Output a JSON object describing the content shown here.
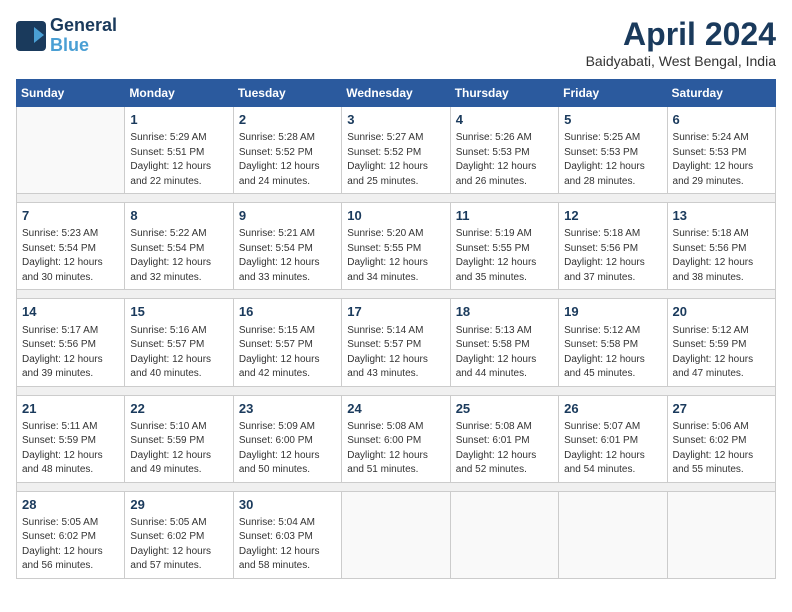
{
  "logo": {
    "line1": "General",
    "line2": "Blue"
  },
  "title": "April 2024",
  "subtitle": "Baidyabati, West Bengal, India",
  "weekdays": [
    "Sunday",
    "Monday",
    "Tuesday",
    "Wednesday",
    "Thursday",
    "Friday",
    "Saturday"
  ],
  "weeks": [
    [
      {
        "day": "",
        "info": ""
      },
      {
        "day": "1",
        "info": "Sunrise: 5:29 AM\nSunset: 5:51 PM\nDaylight: 12 hours\nand 22 minutes."
      },
      {
        "day": "2",
        "info": "Sunrise: 5:28 AM\nSunset: 5:52 PM\nDaylight: 12 hours\nand 24 minutes."
      },
      {
        "day": "3",
        "info": "Sunrise: 5:27 AM\nSunset: 5:52 PM\nDaylight: 12 hours\nand 25 minutes."
      },
      {
        "day": "4",
        "info": "Sunrise: 5:26 AM\nSunset: 5:53 PM\nDaylight: 12 hours\nand 26 minutes."
      },
      {
        "day": "5",
        "info": "Sunrise: 5:25 AM\nSunset: 5:53 PM\nDaylight: 12 hours\nand 28 minutes."
      },
      {
        "day": "6",
        "info": "Sunrise: 5:24 AM\nSunset: 5:53 PM\nDaylight: 12 hours\nand 29 minutes."
      }
    ],
    [
      {
        "day": "7",
        "info": "Sunrise: 5:23 AM\nSunset: 5:54 PM\nDaylight: 12 hours\nand 30 minutes."
      },
      {
        "day": "8",
        "info": "Sunrise: 5:22 AM\nSunset: 5:54 PM\nDaylight: 12 hours\nand 32 minutes."
      },
      {
        "day": "9",
        "info": "Sunrise: 5:21 AM\nSunset: 5:54 PM\nDaylight: 12 hours\nand 33 minutes."
      },
      {
        "day": "10",
        "info": "Sunrise: 5:20 AM\nSunset: 5:55 PM\nDaylight: 12 hours\nand 34 minutes."
      },
      {
        "day": "11",
        "info": "Sunrise: 5:19 AM\nSunset: 5:55 PM\nDaylight: 12 hours\nand 35 minutes."
      },
      {
        "day": "12",
        "info": "Sunrise: 5:18 AM\nSunset: 5:56 PM\nDaylight: 12 hours\nand 37 minutes."
      },
      {
        "day": "13",
        "info": "Sunrise: 5:18 AM\nSunset: 5:56 PM\nDaylight: 12 hours\nand 38 minutes."
      }
    ],
    [
      {
        "day": "14",
        "info": "Sunrise: 5:17 AM\nSunset: 5:56 PM\nDaylight: 12 hours\nand 39 minutes."
      },
      {
        "day": "15",
        "info": "Sunrise: 5:16 AM\nSunset: 5:57 PM\nDaylight: 12 hours\nand 40 minutes."
      },
      {
        "day": "16",
        "info": "Sunrise: 5:15 AM\nSunset: 5:57 PM\nDaylight: 12 hours\nand 42 minutes."
      },
      {
        "day": "17",
        "info": "Sunrise: 5:14 AM\nSunset: 5:57 PM\nDaylight: 12 hours\nand 43 minutes."
      },
      {
        "day": "18",
        "info": "Sunrise: 5:13 AM\nSunset: 5:58 PM\nDaylight: 12 hours\nand 44 minutes."
      },
      {
        "day": "19",
        "info": "Sunrise: 5:12 AM\nSunset: 5:58 PM\nDaylight: 12 hours\nand 45 minutes."
      },
      {
        "day": "20",
        "info": "Sunrise: 5:12 AM\nSunset: 5:59 PM\nDaylight: 12 hours\nand 47 minutes."
      }
    ],
    [
      {
        "day": "21",
        "info": "Sunrise: 5:11 AM\nSunset: 5:59 PM\nDaylight: 12 hours\nand 48 minutes."
      },
      {
        "day": "22",
        "info": "Sunrise: 5:10 AM\nSunset: 5:59 PM\nDaylight: 12 hours\nand 49 minutes."
      },
      {
        "day": "23",
        "info": "Sunrise: 5:09 AM\nSunset: 6:00 PM\nDaylight: 12 hours\nand 50 minutes."
      },
      {
        "day": "24",
        "info": "Sunrise: 5:08 AM\nSunset: 6:00 PM\nDaylight: 12 hours\nand 51 minutes."
      },
      {
        "day": "25",
        "info": "Sunrise: 5:08 AM\nSunset: 6:01 PM\nDaylight: 12 hours\nand 52 minutes."
      },
      {
        "day": "26",
        "info": "Sunrise: 5:07 AM\nSunset: 6:01 PM\nDaylight: 12 hours\nand 54 minutes."
      },
      {
        "day": "27",
        "info": "Sunrise: 5:06 AM\nSunset: 6:02 PM\nDaylight: 12 hours\nand 55 minutes."
      }
    ],
    [
      {
        "day": "28",
        "info": "Sunrise: 5:05 AM\nSunset: 6:02 PM\nDaylight: 12 hours\nand 56 minutes."
      },
      {
        "day": "29",
        "info": "Sunrise: 5:05 AM\nSunset: 6:02 PM\nDaylight: 12 hours\nand 57 minutes."
      },
      {
        "day": "30",
        "info": "Sunrise: 5:04 AM\nSunset: 6:03 PM\nDaylight: 12 hours\nand 58 minutes."
      },
      {
        "day": "",
        "info": ""
      },
      {
        "day": "",
        "info": ""
      },
      {
        "day": "",
        "info": ""
      },
      {
        "day": "",
        "info": ""
      }
    ]
  ]
}
